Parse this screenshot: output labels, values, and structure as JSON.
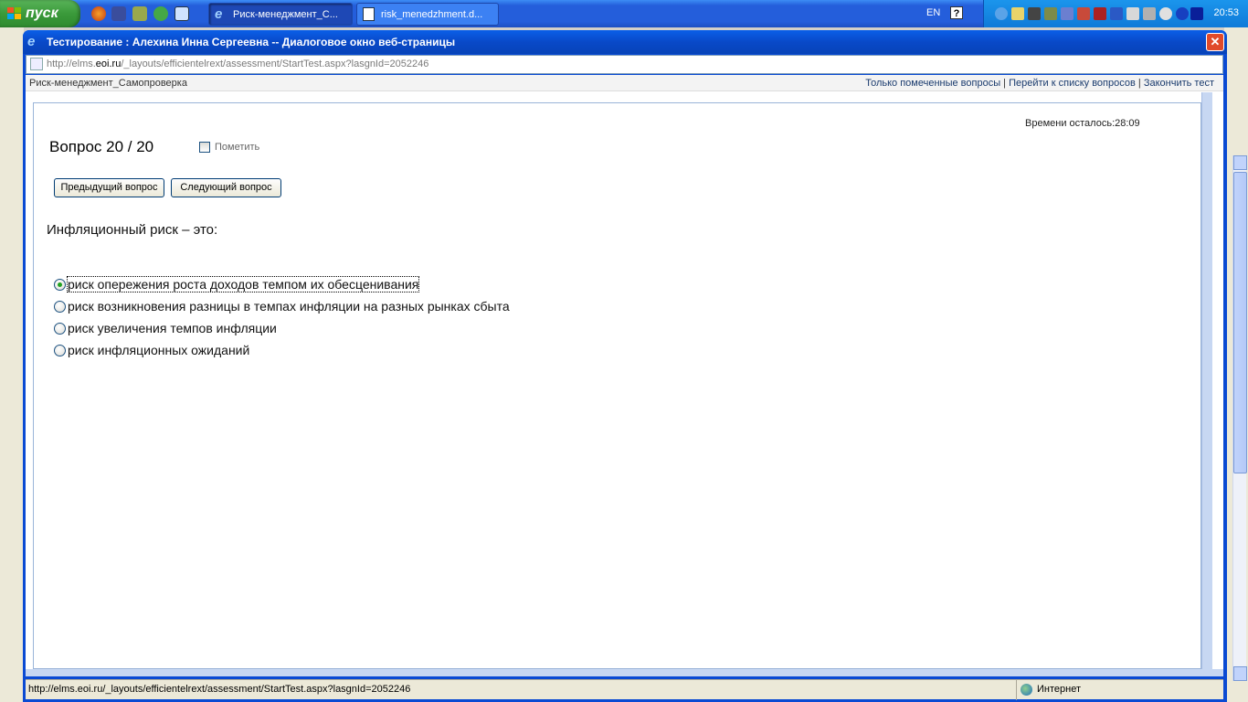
{
  "taskbar": {
    "start_label": "пуск",
    "windows": [
      {
        "label": "Риск-менеджмент_С..."
      },
      {
        "label": "risk_menedzhment.d..."
      }
    ],
    "language": "EN",
    "help": "?",
    "clock": "20:53"
  },
  "dialog": {
    "title": "Тестирование : Алехина Инна Сергеевна -- Диалоговое окно веб-страницы",
    "close_glyph": "✕",
    "address_prefix": "http://elms.",
    "address_host": "eoi.ru",
    "address_path": "/_layouts/efficientelrext/assessment/StartTest.aspx?lasgnId=2052246"
  },
  "page": {
    "course_title": "Риск-менеджмент_Самопроверка",
    "nav": {
      "flagged_only": "Только помеченные вопросы",
      "sep1": " | ",
      "to_list": "Перейти к списку вопросов",
      "sep2": " | ",
      "finish": "Закончить тест"
    },
    "timer": "Времени осталось:28:09",
    "question_number": "Вопрос 20 / 20",
    "mark_label": "Пометить",
    "prev_button": "Предыдущий вопрос",
    "next_button": "Следующий вопрос",
    "question_text": "Инфляционный риск – это:",
    "options": [
      {
        "text": "риск опережения роста доходов темпом их обесценивания",
        "selected": true
      },
      {
        "text": "риск возникновения разницы в темпах инфляции на разных рынках сбыта",
        "selected": false
      },
      {
        "text": "риск увеличения темпов инфляции",
        "selected": false
      },
      {
        "text": "риск инфляционных ожиданий",
        "selected": false
      }
    ]
  },
  "statusbar": {
    "url": "http://elms.eoi.ru/_layouts/efficientelrext/assessment/StartTest.aspx?lasgnId=2052246",
    "zone": "Интернет"
  },
  "colors": {
    "titlebar": "#0949c8",
    "taskbar": "#245edb",
    "start": "#3a9a3a",
    "selected_radio": "#21a121"
  }
}
